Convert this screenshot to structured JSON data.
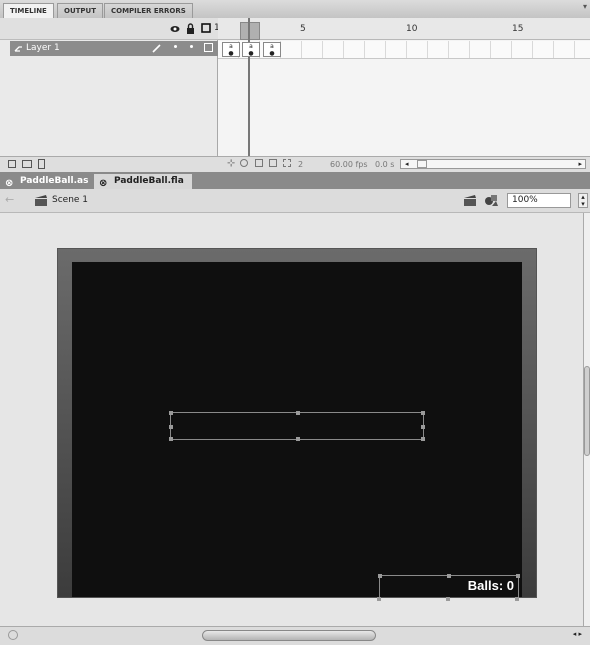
{
  "panel_tabs": [
    "TIMELINE",
    "OUTPUT",
    "COMPILER ERRORS"
  ],
  "panel_menu_icon": "▾",
  "layer_header": {
    "eye_icon": "eye",
    "lock_icon": "lock",
    "outline_icon": "square-outline",
    "first_frame": "1"
  },
  "layer": {
    "name": "Layer 1",
    "pencil_icon": "pencil"
  },
  "frame_numbers": [
    "5",
    "10",
    "15"
  ],
  "keyframes": [
    "a",
    "a",
    "a"
  ],
  "timeline_status": {
    "current_frame": "2",
    "frame_rate": "60.00 fps",
    "elapsed": "0.0 s"
  },
  "doc_tabs": [
    {
      "label": "PaddleBall.as",
      "active": false
    },
    {
      "label": "PaddleBall.fla",
      "active": true
    }
  ],
  "edit_bar": {
    "scene": "Scene 1",
    "zoom": "100%"
  },
  "stage": {
    "balls_label": "Balls: 0"
  }
}
